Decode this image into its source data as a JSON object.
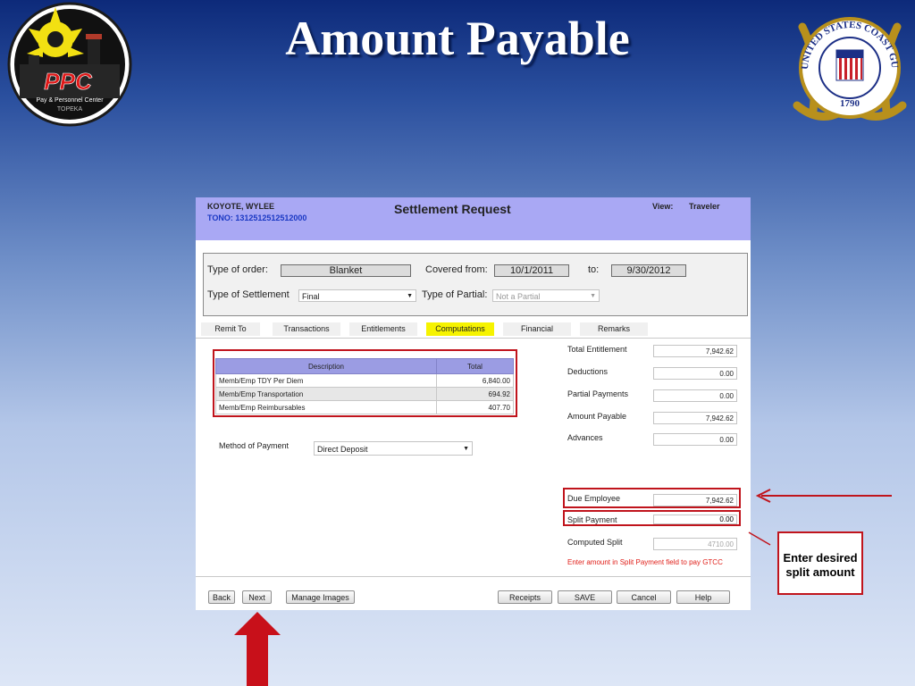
{
  "slide": {
    "title": "Amount Payable",
    "ppc_logo_text": "PPC",
    "ppc_logo_sub": "Pay & Personnel Center",
    "ppc_logo_city": "TOPEKA",
    "uscg_seal_text": "UNITED STATES COAST GUARD",
    "uscg_seal_year": "1790",
    "callout_line1": "Enter desired",
    "callout_line2": "split amount"
  },
  "header": {
    "name": "KOYOTE, WYLEE",
    "tono": "TONO: 1312512512512000",
    "title": "Settlement Request",
    "view_label": "View:",
    "view_value": "Traveler"
  },
  "order": {
    "type_of_order_label": "Type of order:",
    "type_of_order_value": "Blanket",
    "covered_from_label": "Covered from:",
    "covered_from_value": "10/1/2011",
    "to_label": "to:",
    "to_value": "9/30/2012",
    "type_of_settlement_label": "Type of Settlement",
    "type_of_settlement_value": "Final",
    "type_of_partial_label": "Type of Partial:",
    "type_of_partial_value": "Not a Partial"
  },
  "tabs": [
    {
      "label": "Remit To"
    },
    {
      "label": "Transactions"
    },
    {
      "label": "Entitlements"
    },
    {
      "label": "Computations"
    },
    {
      "label": "Financial"
    },
    {
      "label": "Remarks"
    }
  ],
  "computations": {
    "columns": [
      "Description",
      "Total"
    ],
    "rows": [
      {
        "description": "Memb/Emp TDY Per Diem",
        "total": "6,840.00"
      },
      {
        "description": "Memb/Emp Transportation",
        "total": "694.92"
      },
      {
        "description": "Memb/Emp Reimbursables",
        "total": "407.70"
      }
    ]
  },
  "payment": {
    "method_label": "Method of Payment",
    "method_value": "Direct Deposit"
  },
  "summary": {
    "total_entitlement_label": "Total Entitlement",
    "total_entitlement_value": "7,942.62",
    "deductions_label": "Deductions",
    "deductions_value": "0.00",
    "partial_payments_label": "Partial Payments",
    "partial_payments_value": "0.00",
    "amount_payable_label": "Amount Payable",
    "amount_payable_value": "7,942.62",
    "advances_label": "Advances",
    "advances_value": "0.00",
    "due_employee_label": "Due Employee",
    "due_employee_value": "7,942.62",
    "split_payment_label": "Split Payment",
    "split_payment_value": "0.00",
    "computed_split_label": "Computed Split",
    "computed_split_value": "4710.00",
    "note": "Enter amount in Split Payment field to pay GTCC"
  },
  "buttons": {
    "back": "Back",
    "next": "Next",
    "manage_images": "Manage Images",
    "receipts": "Receipts",
    "save": "SAVE",
    "cancel": "Cancel",
    "help": "Help"
  },
  "colors": {
    "header_bg": "#a9a8f4",
    "active_tab": "#f6f300",
    "highlight_red": "#c0141c",
    "tono_blue": "#1a38c4"
  }
}
